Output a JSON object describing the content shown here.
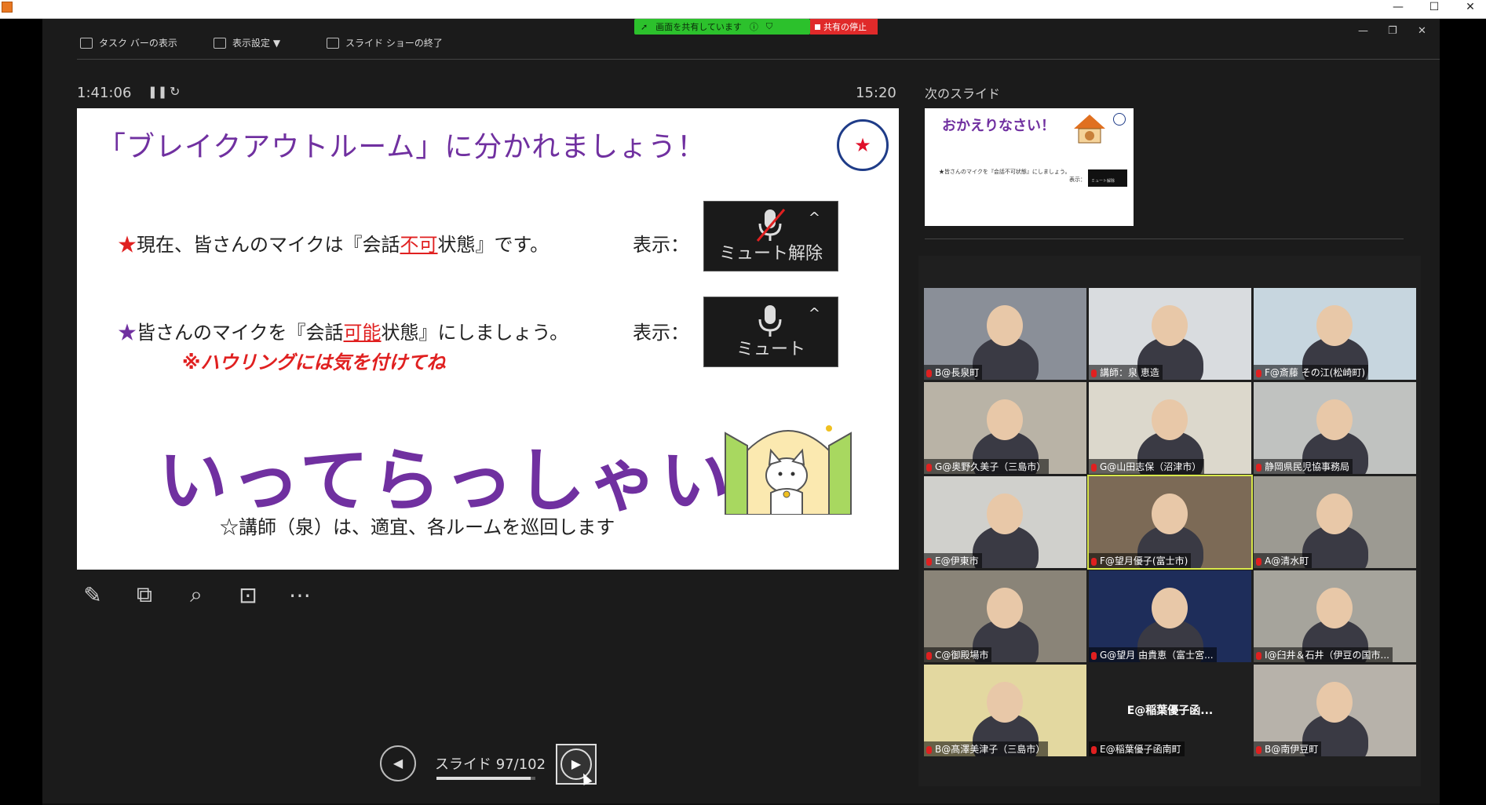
{
  "toolbar": {
    "taskbar": "タスク バーの表示",
    "display_settings": "表示設定 ▼",
    "end_show": "スライド ショーの終了"
  },
  "share": {
    "sharing_text": "画面を共有しています",
    "stop_text": "共有の停止"
  },
  "presenter": {
    "elapsed": "1:41:06",
    "clock": "15:20"
  },
  "slide": {
    "title": "「ブレイクアウトルーム」に分かれましょう！",
    "star": "★",
    "bullet1_star": "★",
    "bullet1_pre": "現在、皆さんのマイクは『会話",
    "bullet1_em": "不可",
    "bullet1_post": "状態』です。",
    "bullet2_star": "★",
    "bullet2_pre": "皆さんのマイクを『会話",
    "bullet2_em": "可能",
    "bullet2_post": "状態』にしましょう。",
    "hyoji1": "表示：",
    "hyoji2": "表示：",
    "unmute_label": "ミュート解除",
    "mute_label": "ミュート",
    "warning": "※ハウリングには気を付けてね",
    "big": "いってらっしゃい！",
    "note": "☆講師（泉）は、適宜、各ルームを巡回します"
  },
  "nav": {
    "label": "スライド 97/102",
    "current": 97,
    "total": 102,
    "progress": 0.951
  },
  "next_slide": {
    "label": "次のスライド",
    "title": "おかえりなさい！",
    "line": "★皆さんのマイクを『会話不可状態』にしましょう。",
    "hyoji": "表示：",
    "mini": "ミュート解除"
  },
  "participants": [
    {
      "name": "B@長泉町"
    },
    {
      "name": "講師：泉 恵造"
    },
    {
      "name": "F@斎藤 その江(松崎町)"
    },
    {
      "name": "G@奥野久美子（三島市）"
    },
    {
      "name": "G@山田志保（沼津市）"
    },
    {
      "name": "静岡県民児協事務局"
    },
    {
      "name": "E@伊東市"
    },
    {
      "name": "F@望月優子(富士市)"
    },
    {
      "name": "A@清水町"
    },
    {
      "name": "C@御殿場市"
    },
    {
      "name": "G@望月 由貴恵（富士宮..."
    },
    {
      "name": "I@臼井＆石井（伊豆の国市..."
    },
    {
      "name": "B@髙澤美津子（三島市）"
    },
    {
      "name": "E@稲葉優子函南町",
      "center": "E@稲葉優子函..."
    },
    {
      "name": "B@南伊豆町"
    }
  ],
  "colors": {
    "accent_purple": "#7030a0",
    "alert_red": "#e02020",
    "share_green": "#2cc12c"
  }
}
